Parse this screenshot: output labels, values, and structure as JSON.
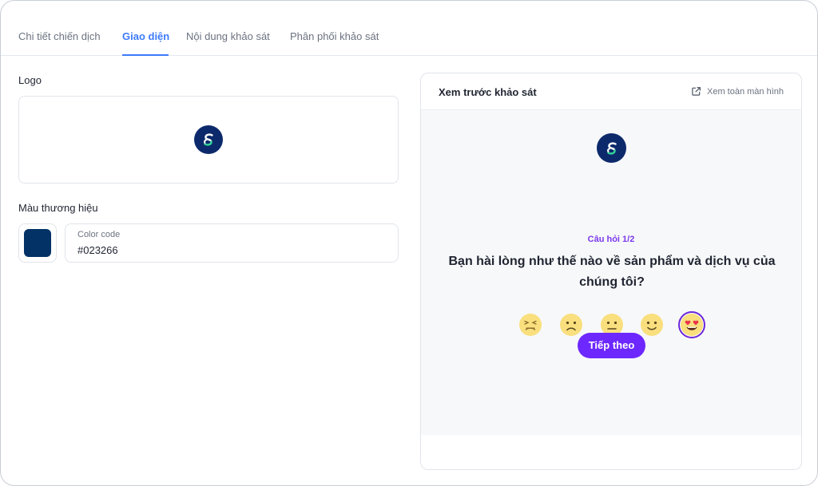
{
  "tabs": [
    {
      "label": "Chi tiết chiến dịch"
    },
    {
      "label": "Giao diện"
    },
    {
      "label": "Nội dung khảo sát"
    },
    {
      "label": "Phân phối khảo sát"
    }
  ],
  "active_tab": "Giao diện",
  "logo_section": {
    "label": "Logo",
    "icon": "brand-logo-icon"
  },
  "brand_color": {
    "label": "Màu thương hiệu",
    "field_label": "Color code",
    "value": "#023266"
  },
  "preview": {
    "title": "Xem trước khảo sát",
    "fullscreen_label": "Xem toàn màn hình",
    "question_number": "Câu hỏi 1/2",
    "question": "Bạn hài lòng như thế nào về sản phẩm và dịch vụ của chúng tôi?",
    "emojis": [
      "tired-face-icon",
      "frowning-face-icon",
      "neutral-face-icon",
      "slightly-smiling-face-icon",
      "heart-eyes-face-icon"
    ],
    "selected_emoji": "heart-eyes-face-icon",
    "next_button": "Tiếp theo"
  },
  "colors": {
    "accent_tab": "#3d7bfa",
    "button": "#6d28ff",
    "question_number": "#7c3aed",
    "logo_bg": "#0c2a6b",
    "emoji_face": "#f9df7d"
  }
}
